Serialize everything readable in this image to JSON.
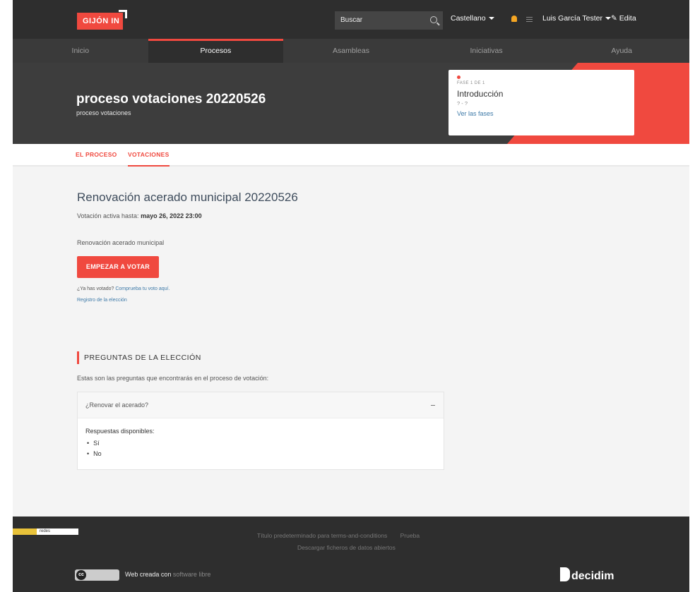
{
  "header": {
    "logo_text": "GIJÓN IN",
    "search_placeholder": "Buscar",
    "language": "Castellano",
    "user_name": "Luis García Tester",
    "edit_label": "Edita"
  },
  "nav": {
    "items": [
      {
        "label": "Inicio",
        "active": false
      },
      {
        "label": "Procesos",
        "active": true
      },
      {
        "label": "Asambleas",
        "active": false
      },
      {
        "label": "Iniciativas",
        "active": false
      },
      {
        "label": "Ayuda",
        "active": false
      }
    ]
  },
  "hero": {
    "title": "proceso votaciones 20220526",
    "subtitle": "proceso votaciones",
    "phase_label": "FASE 1 DE 1",
    "phase_name": "Introducción",
    "phase_dates": "? - ?",
    "phase_link": "Ver las fases"
  },
  "subnav": {
    "tab_process": "EL PROCESO",
    "tab_votes": "VOTACIONES"
  },
  "election": {
    "title": "Renovación acerado municipal 20220526",
    "active_until_label": "Votación activa hasta:",
    "active_until_value": "mayo 26, 2022 23:00",
    "description": "Renovación acerado municipal",
    "vote_button": "EMPEZAR A VOTAR",
    "voted_question": "¿Ya has votado?",
    "verify_link": "Comprueba tu voto aquí.",
    "registry_link": "Registro de la elección"
  },
  "questions": {
    "header": "PREGUNTAS DE LA ELECCIÓN",
    "intro": "Estas son las preguntas que encontrarás en el proceso de votación:",
    "items": [
      {
        "question": "¿Renovar el acerado?",
        "answers_label": "Respuestas disponibles:",
        "answers": [
          "Sí",
          "No"
        ]
      }
    ]
  },
  "footer": {
    "badge_text": "redes",
    "terms_link": "Título predeterminado para terms-and-conditions",
    "test_link": "Prueba",
    "open_data_link": "Descargar ficheros de datos abiertos",
    "cc_label": "cc",
    "credit_prefix": "Web creada con",
    "credit_link": "software libre",
    "brand": "decidim"
  },
  "colors": {
    "accent": "#f0493f",
    "dark": "#2e2e2e",
    "link": "#3e7aa8"
  }
}
